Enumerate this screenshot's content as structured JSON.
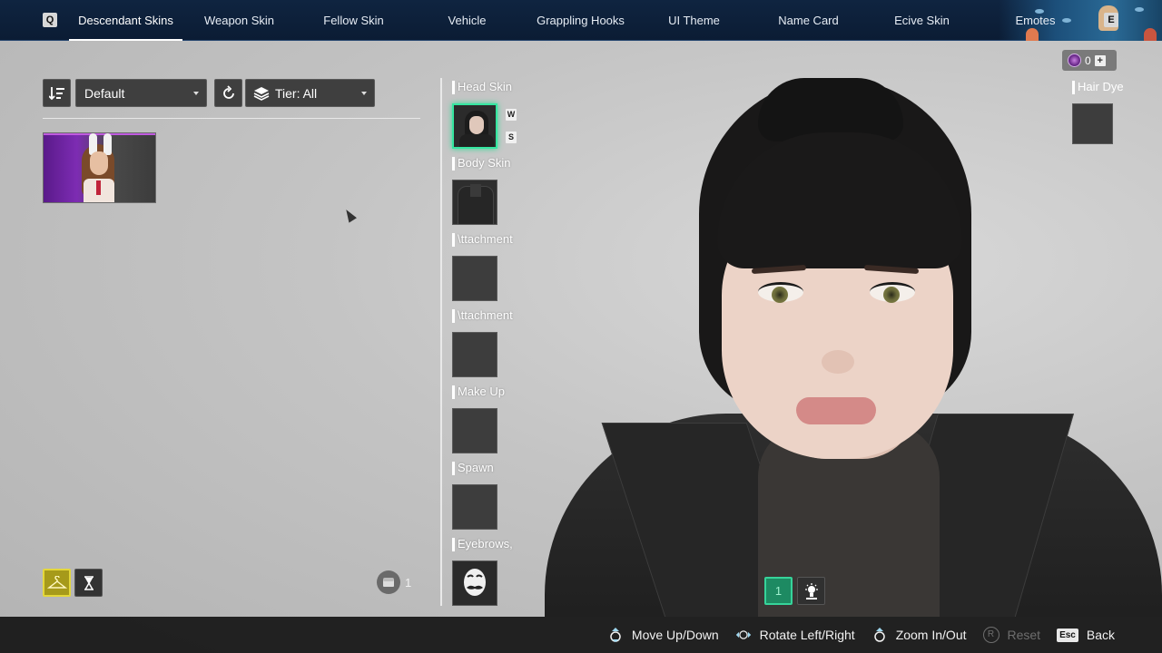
{
  "top_nav": {
    "prev_key": "Q",
    "next_key": "E",
    "tabs": [
      {
        "label": "Descendant Skins",
        "active": true
      },
      {
        "label": "Weapon Skin",
        "active": false
      },
      {
        "label": "Fellow Skin",
        "active": false
      },
      {
        "label": "Vehicle",
        "active": false
      },
      {
        "label": "Grappling Hooks",
        "active": false
      },
      {
        "label": "UI Theme",
        "active": false
      },
      {
        "label": "Name Card",
        "active": false
      },
      {
        "label": "Ecive Skin",
        "active": false
      },
      {
        "label": "Emotes",
        "active": false
      }
    ]
  },
  "filters": {
    "sort_icon": "sort-icon",
    "sort_value": "Default",
    "reset_icon": "refresh-icon",
    "tier_icon": "layers-icon",
    "tier_value": "Tier: All"
  },
  "left_footer": {
    "wardrobe_icon": "hanger-icon",
    "hourglass_icon": "hourglass-icon",
    "chest_icon": "chest-icon",
    "chest_count": "1"
  },
  "slots": {
    "head": "Head Skin",
    "head_key_up": "W",
    "head_key_down": "S",
    "body": "Body Skin",
    "attachment_1": "\\ttachment",
    "attachment_2": "\\ttachment",
    "makeup": "Make Up",
    "spawn": "Spawn",
    "eyebrows": "Eyebrows,"
  },
  "right_panel": {
    "currency_value": "0",
    "currency_plus": "+",
    "hair_dye": "Hair Dye"
  },
  "pose_buttons": {
    "pose_1": "1",
    "light_icon": "lamp-icon"
  },
  "hints": [
    {
      "label": "Move Up/Down",
      "icon": "right-stick-icon",
      "disabled": false
    },
    {
      "label": "Rotate Left/Right",
      "icon": "left-right-stick-icon",
      "disabled": false
    },
    {
      "label": "Zoom In/Out",
      "icon": "stick-press-icon",
      "disabled": false
    },
    {
      "label": "Reset",
      "key": "R",
      "disabled": true
    },
    {
      "label": "Back",
      "key": "Esc",
      "disabled": false
    }
  ],
  "colors": {
    "nav_bg": "#0b1c34",
    "selected_glow": "#35e6a0",
    "wardrobe_active": "#a69a1a"
  }
}
